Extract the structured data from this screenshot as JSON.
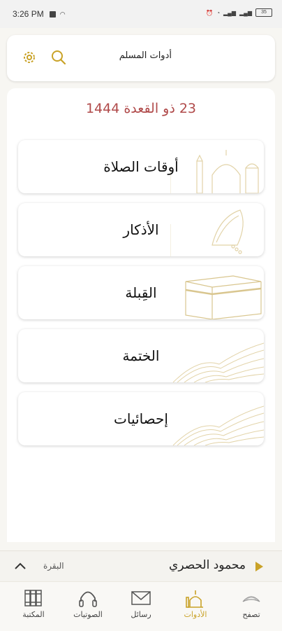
{
  "status_bar": {
    "time": "3:26 PM",
    "battery": "35"
  },
  "header": {
    "title": "أدوات المسلم"
  },
  "date": "23 ذو القعدة 1444",
  "tools": [
    {
      "label": "أوقات الصلاة",
      "icon": "mosque-icon"
    },
    {
      "label": "الأذكار",
      "icon": "prayer-hands-icon"
    },
    {
      "label": "القِبلة",
      "icon": "kaaba-icon"
    },
    {
      "label": "الختمة",
      "icon": "open-book-icon"
    },
    {
      "label": "إحصائيات",
      "icon": "open-book-icon"
    }
  ],
  "player": {
    "reciter": "محمود الحصري",
    "surah": "البقرة"
  },
  "nav": [
    {
      "label": "تصفح",
      "icon": "quran-icon"
    },
    {
      "label": "الأدوات",
      "icon": "tools-mosque-icon",
      "active": true
    },
    {
      "label": "رسائل",
      "icon": "envelope-icon"
    },
    {
      "label": "الصوتيات",
      "icon": "headphones-icon"
    },
    {
      "label": "المكتبة",
      "icon": "books-icon"
    }
  ],
  "colors": {
    "accent": "#c9a227",
    "date": "#b04a4a"
  }
}
